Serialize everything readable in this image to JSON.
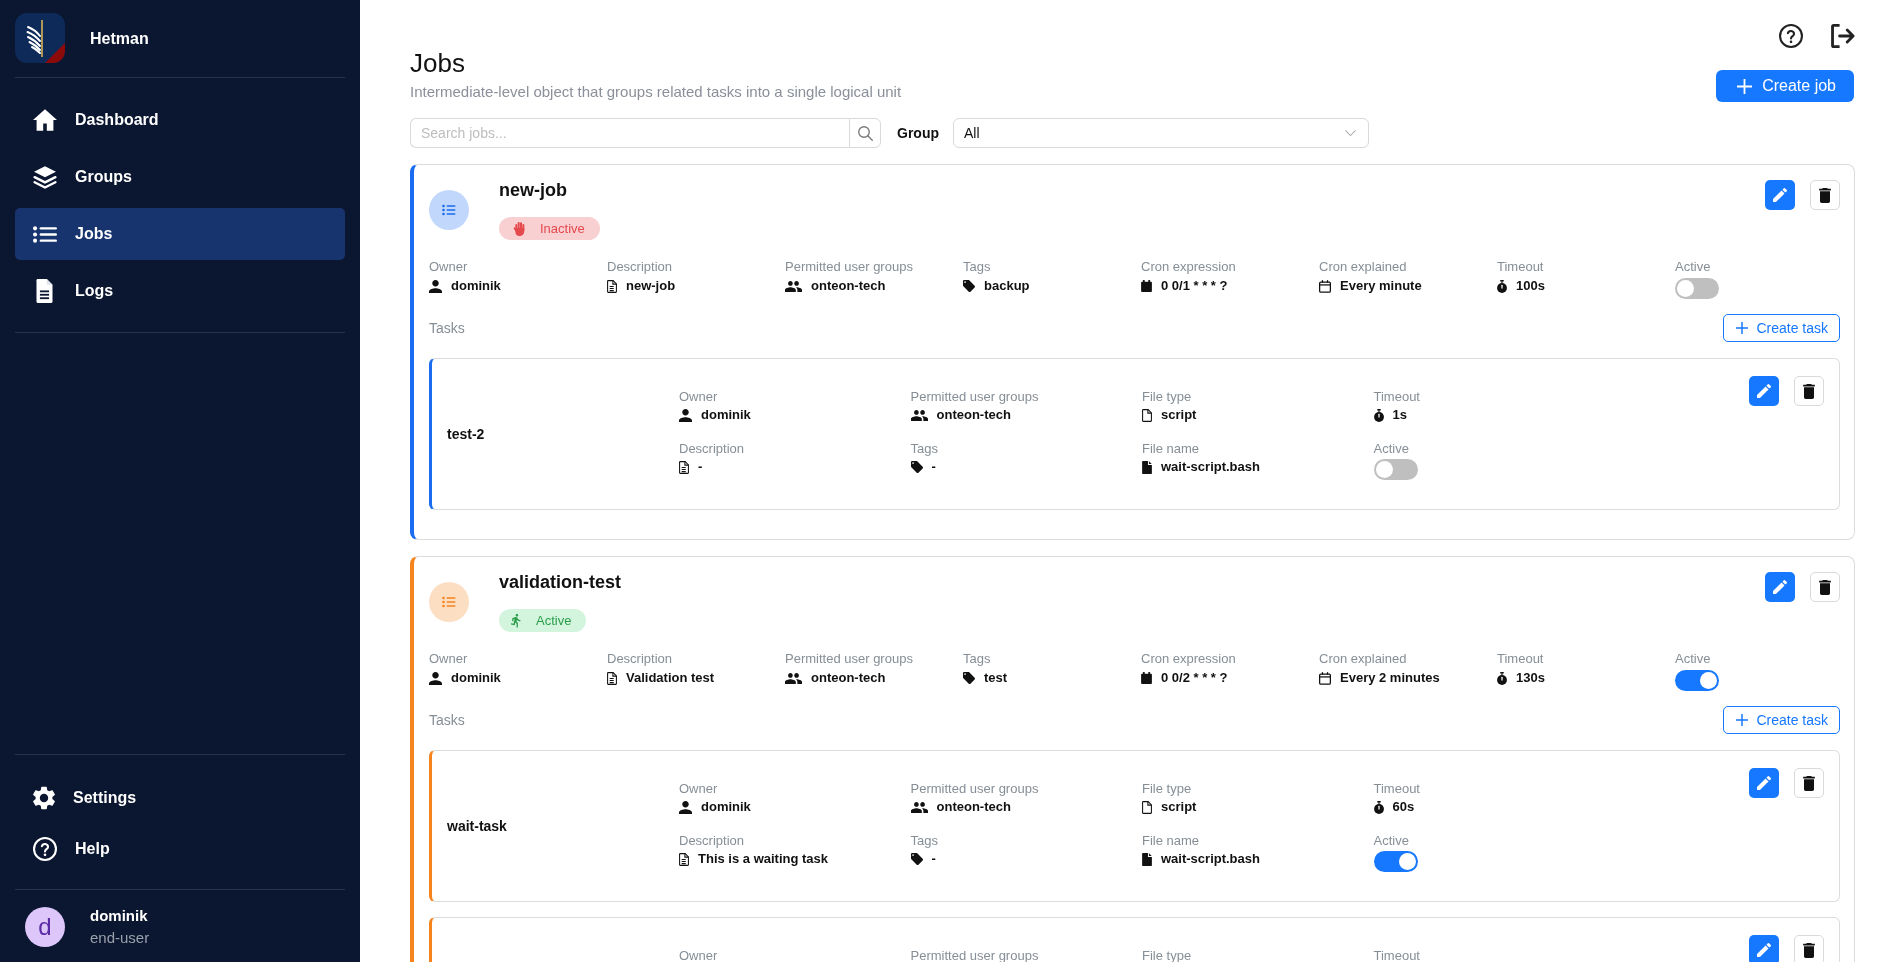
{
  "sidebar": {
    "brand": "Hetman",
    "nav": [
      {
        "label": "Dashboard",
        "selected": false
      },
      {
        "label": "Groups",
        "selected": false
      },
      {
        "label": "Jobs",
        "selected": true
      },
      {
        "label": "Logs",
        "selected": false
      }
    ],
    "bottom_nav": [
      {
        "label": "Settings",
        "selected": false
      },
      {
        "label": "Help",
        "selected": false
      }
    ],
    "user": {
      "initial": "d",
      "name": "dominik",
      "role": "end-user"
    }
  },
  "header": {
    "title": "Jobs",
    "subtitle": "Intermediate-level object that groups related tasks into a single logical unit",
    "create_button": "Create job"
  },
  "filters": {
    "search": {
      "placeholder": "Search jobs..."
    },
    "group_label": "Group",
    "group_select": {
      "value": "All"
    }
  },
  "jobs": [
    {
      "name": "new-job",
      "color": "#1a6cf0",
      "status": {
        "kind": "inactive",
        "label": "Inactive"
      },
      "fields": [
        {
          "kind": "owner",
          "label": "Owner",
          "value": "dominik"
        },
        {
          "kind": "description",
          "label": "Description",
          "value": "new-job"
        },
        {
          "kind": "groups",
          "label": "Permitted user groups",
          "value": "onteon-tech"
        },
        {
          "kind": "tags",
          "label": "Tags",
          "value": "backup"
        },
        {
          "kind": "cron",
          "label": "Cron expression",
          "value": "0 0/1 * * * ?"
        },
        {
          "kind": "schedule",
          "label": "Cron explained",
          "value": "Every minute"
        },
        {
          "kind": "timeout",
          "label": "Timeout",
          "value": "100s"
        },
        {
          "kind": "toggle",
          "label": "Active",
          "on": false
        }
      ],
      "tasks_label": "Tasks",
      "create_task_button": "Create task",
      "tasks": [
        {
          "name": "test-2",
          "fields": [
            {
              "kind": "owner",
              "label": "Owner",
              "value": "dominik"
            },
            {
              "kind": "groups",
              "label": "Permitted user groups",
              "value": "onteon-tech"
            },
            {
              "kind": "filetype",
              "label": "File type",
              "value": "script"
            },
            {
              "kind": "timeout",
              "label": "Timeout",
              "value": "1s"
            },
            {
              "kind": "description",
              "label": "Description",
              "value": "-"
            },
            {
              "kind": "tags",
              "label": "Tags",
              "value": "-"
            },
            {
              "kind": "filename",
              "label": "File name",
              "value": "wait-script.bash"
            },
            {
              "kind": "toggle",
              "label": "Active",
              "on": false
            }
          ]
        }
      ]
    },
    {
      "name": "validation-test",
      "color": "#f5841f",
      "status": {
        "kind": "active",
        "label": "Active"
      },
      "fields": [
        {
          "kind": "owner",
          "label": "Owner",
          "value": "dominik"
        },
        {
          "kind": "description",
          "label": "Description",
          "value": "Validation test"
        },
        {
          "kind": "groups",
          "label": "Permitted user groups",
          "value": "onteon-tech"
        },
        {
          "kind": "tags",
          "label": "Tags",
          "value": "test"
        },
        {
          "kind": "cron",
          "label": "Cron expression",
          "value": "0 0/2 * * * ?"
        },
        {
          "kind": "schedule",
          "label": "Cron explained",
          "value": "Every 2 minutes"
        },
        {
          "kind": "timeout",
          "label": "Timeout",
          "value": "130s"
        },
        {
          "kind": "toggle",
          "label": "Active",
          "on": true
        }
      ],
      "tasks_label": "Tasks",
      "create_task_button": "Create task",
      "tasks": [
        {
          "name": "wait-task",
          "fields": [
            {
              "kind": "owner",
              "label": "Owner",
              "value": "dominik"
            },
            {
              "kind": "groups",
              "label": "Permitted user groups",
              "value": "onteon-tech"
            },
            {
              "kind": "filetype",
              "label": "File type",
              "value": "script"
            },
            {
              "kind": "timeout",
              "label": "Timeout",
              "value": "60s"
            },
            {
              "kind": "description",
              "label": "Description",
              "value": "This is a waiting task"
            },
            {
              "kind": "tags",
              "label": "Tags",
              "value": "-"
            },
            {
              "kind": "filename",
              "label": "File name",
              "value": "wait-script.bash"
            },
            {
              "kind": "toggle",
              "label": "Active",
              "on": true
            }
          ]
        },
        {
          "fields": [
            {
              "kind": "owner",
              "label": "Owner"
            },
            {
              "kind": "groups",
              "label": "Permitted user groups"
            },
            {
              "kind": "filetype",
              "label": "File type"
            },
            {
              "kind": "timeout",
              "label": "Timeout"
            }
          ]
        }
      ]
    }
  ]
}
